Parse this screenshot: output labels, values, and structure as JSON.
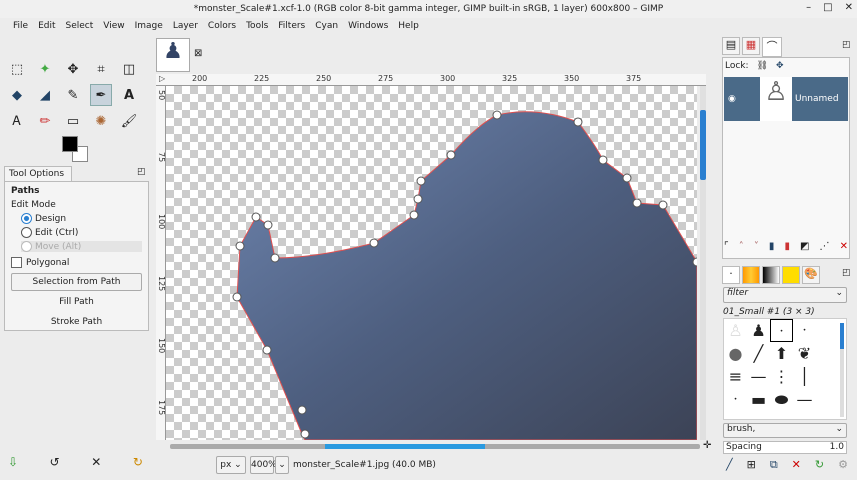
{
  "window": {
    "title": "*monster_Scale#1.xcf-1.0 (RGB color 8-bit gamma integer, GIMP built-in sRGB, 1 layer) 600x800 – GIMP",
    "min": "–",
    "max": "□",
    "close": "✕"
  },
  "menu": [
    "File",
    "Edit",
    "Select",
    "View",
    "Image",
    "Layer",
    "Colors",
    "Tools",
    "Filters",
    "Cyan",
    "Windows",
    "Help"
  ],
  "tool_options": {
    "tab": "Tool Options",
    "section": "Paths",
    "edit_mode_label": "Edit Mode",
    "modes": [
      {
        "label": "Design",
        "selected": true
      },
      {
        "label": "Edit (Ctrl)",
        "selected": false
      },
      {
        "label": "Move (Alt)",
        "selected": false
      }
    ],
    "polygonal": "Polygonal",
    "selection_from_path": "Selection from Path",
    "fill_path": "Fill Path",
    "stroke_path": "Stroke Path"
  },
  "rulers": {
    "h": [
      "200",
      "225",
      "250",
      "275",
      "300",
      "325",
      "350",
      "375"
    ],
    "v": [
      "50",
      "75",
      "100",
      "125",
      "150",
      "175"
    ]
  },
  "status": {
    "unit": "px",
    "zoom": "400%",
    "file": "monster_Scale#1.jpg (40.0 MB)"
  },
  "layers": {
    "lock_label": "Lock:",
    "layer_name": "Unnamed"
  },
  "brushes": {
    "filter": "filter",
    "brush_name": "01_Small #1 (3 × 3)",
    "tag": "brush,",
    "spacing_label": "Spacing",
    "spacing_value": "1.0"
  },
  "colors": {
    "accent": "#2a7fd0",
    "layer_selected": "#4a6a88",
    "path": "#e05050"
  }
}
